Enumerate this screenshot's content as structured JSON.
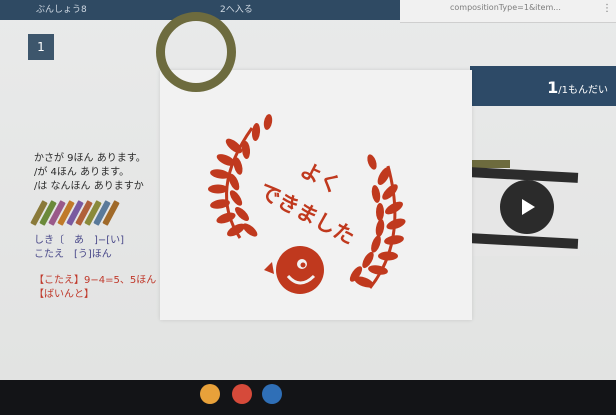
{
  "browser": {
    "url_fragment": "compositionType=1&item..."
  },
  "header": {
    "crumb_left": "ぶんしょう8",
    "crumb_right": "2へ入る"
  },
  "question": {
    "number_badge": "1",
    "counter_current": "1",
    "counter_suffix": "/1もんだい"
  },
  "problem": {
    "lines": [
      "かさが 9ほん あります。",
      "/が 4ほん あります。",
      "/は なんほん ありますか"
    ],
    "formula_lines": [
      "しき〔　あ　]−[い]",
      "こたえ　[う]ほん"
    ],
    "answer_lines": [
      "【こたえ】9−4=5、5ほん",
      "【ばいんと】"
    ],
    "pencil_colors": [
      "#8a7a3a",
      "#6b8a3a",
      "#9a5a8a",
      "#c07a2a",
      "#7a5aa0",
      "#b0603a",
      "#8a8a3a",
      "#5a7a9a",
      "#a06a2a"
    ]
  },
  "stamp": {
    "line1": "よく",
    "line2": "できました",
    "color": "#c0391e"
  },
  "dock": {
    "icon_colors": [
      "#e8a13a",
      "#d64a3a",
      "#2f6fb7"
    ]
  }
}
